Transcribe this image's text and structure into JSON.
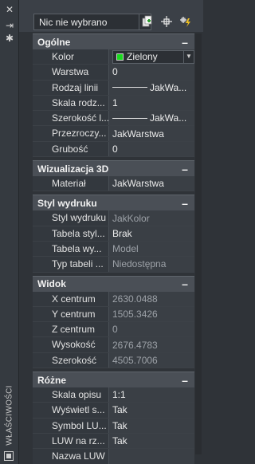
{
  "palette_title": "WŁAŚCIWOŚCI",
  "strip_icons": [
    {
      "name": "close-icon",
      "glyph": "✕"
    },
    {
      "name": "auto-hide-icon",
      "glyph": "⇥"
    },
    {
      "name": "settings-icon",
      "glyph": "✱"
    }
  ],
  "selection": {
    "value": "Nic nie wybrano"
  },
  "toolbar": [
    {
      "name": "toggle-pickadd-icon"
    },
    {
      "name": "select-objects-icon"
    },
    {
      "name": "quick-select-icon"
    }
  ],
  "sections": [
    {
      "title": "Ogólne",
      "collapse": "–",
      "rows": [
        {
          "label": "Kolor",
          "value": "Zielony",
          "kind": "color-select",
          "swatch": "#19d81e"
        },
        {
          "label": "Warstwa",
          "value": "0"
        },
        {
          "label": "Rodzaj linii",
          "value": "JakWa...",
          "kind": "line"
        },
        {
          "label": "Skala rodz...",
          "value": "1"
        },
        {
          "label": "Szerokość l...",
          "value": "JakWa...",
          "kind": "line"
        },
        {
          "label": "Przezroczy...",
          "value": "JakWarstwa"
        },
        {
          "label": "Grubość",
          "value": "0"
        }
      ]
    },
    {
      "title": "Wizualizacja 3D",
      "collapse": "–",
      "rows": [
        {
          "label": "Materiał",
          "value": "JakWarstwa"
        }
      ]
    },
    {
      "title": "Styl wydruku",
      "collapse": "–",
      "rows": [
        {
          "label": "Styl wydruku",
          "value": "JakKolor",
          "dim": true
        },
        {
          "label": "Tabela styl...",
          "value": "Brak"
        },
        {
          "label": "Tabela wy...",
          "value": "Model",
          "dim": true
        },
        {
          "label": "Typ tabeli ...",
          "value": "Niedostępna",
          "dim": true
        }
      ]
    },
    {
      "title": "Widok",
      "collapse": "–",
      "rows": [
        {
          "label": "X centrum",
          "value": "2630.0488",
          "dim": true
        },
        {
          "label": "Y centrum",
          "value": "1505.3426",
          "dim": true
        },
        {
          "label": "Z centrum",
          "value": "0",
          "dim": true
        },
        {
          "label": "Wysokość",
          "value": "2676.4783",
          "dim": true
        },
        {
          "label": "Szerokość",
          "value": "4505.7006",
          "dim": true
        }
      ]
    },
    {
      "title": "Różne",
      "collapse": "–",
      "rows": [
        {
          "label": "Skala opisu",
          "value": "1:1"
        },
        {
          "label": "Wyświetl s...",
          "value": "Tak"
        },
        {
          "label": "Symbol LU...",
          "value": "Tak"
        },
        {
          "label": "LUW na rz...",
          "value": "Tak"
        },
        {
          "label": "Nazwa LUW",
          "value": ""
        }
      ]
    }
  ]
}
